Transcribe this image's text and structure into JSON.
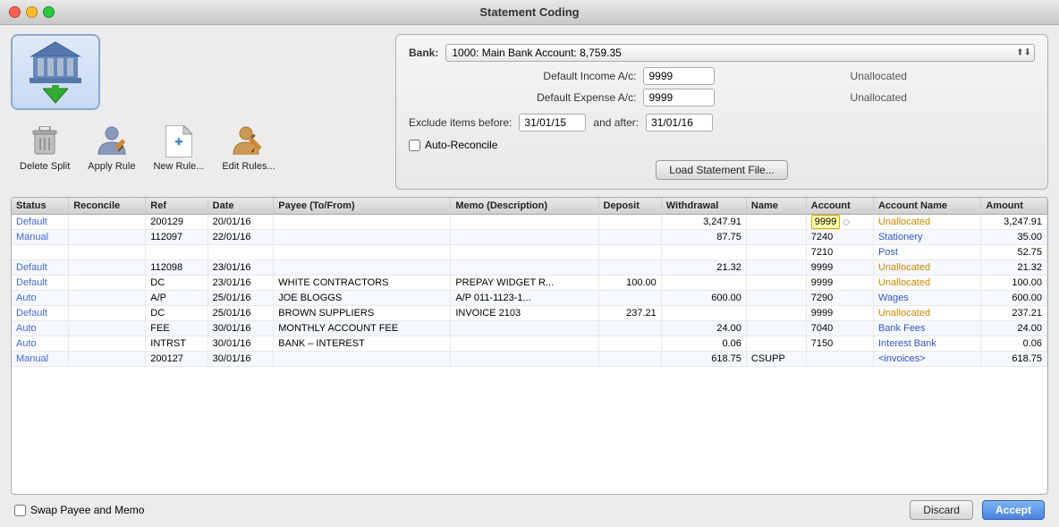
{
  "window": {
    "title": "Statement Coding"
  },
  "header": {
    "bank_label": "Bank:",
    "bank_value": "1000: Main Bank Account: 8,759.35",
    "default_income_label": "Default Income A/c:",
    "default_income_value": "9999",
    "default_income_note": "Unallocated",
    "default_expense_label": "Default Expense A/c:",
    "default_expense_value": "9999",
    "default_expense_note": "Unallocated",
    "exclude_before_label": "Exclude items before:",
    "exclude_before_value": "31/01/15",
    "and_after_label": "and after:",
    "exclude_after_value": "31/01/16",
    "auto_reconcile_label": "Auto-Reconcile",
    "load_btn": "Load Statement File..."
  },
  "toolbar": {
    "delete_split_label": "Delete Split",
    "apply_rule_label": "Apply Rule",
    "new_rule_label": "New Rule...",
    "edit_rules_label": "Edit Rules..."
  },
  "table": {
    "columns": [
      "Status",
      "Reconcile",
      "Ref",
      "Date",
      "Payee (To/From)",
      "Memo (Description)",
      "Deposit",
      "Withdrawal",
      "Name",
      "Account",
      "Account Name",
      "Amount"
    ],
    "rows": [
      {
        "status": "Default",
        "reconcile": "",
        "ref": "200129",
        "date": "20/01/16",
        "payee": "",
        "memo": "",
        "deposit": "",
        "withdrawal": "3,247.91",
        "name": "",
        "account": "9999",
        "account_arrow": "◇",
        "account_name": "Unallocated",
        "amount": "3,247.91",
        "status_class": "status-default",
        "acct_highlight": true
      },
      {
        "status": "Manual",
        "reconcile": "",
        "ref": "112097",
        "date": "22/01/16",
        "payee": "",
        "memo": "",
        "deposit": "",
        "withdrawal": "87.75",
        "name": "",
        "account": "7240",
        "account_arrow": "",
        "account_name": "Stationery",
        "amount": "35.00",
        "status_class": "status-manual",
        "acct_highlight": false
      },
      {
        "status": "",
        "reconcile": "",
        "ref": "",
        "date": "",
        "payee": "",
        "memo": "",
        "deposit": "",
        "withdrawal": "",
        "name": "",
        "account": "7210",
        "account_arrow": "",
        "account_name": "Post",
        "amount": "52.75",
        "status_class": "",
        "acct_highlight": false
      },
      {
        "status": "Default",
        "reconcile": "",
        "ref": "112098",
        "date": "23/01/16",
        "payee": "",
        "memo": "",
        "deposit": "",
        "withdrawal": "21.32",
        "name": "",
        "account": "9999",
        "account_arrow": "",
        "account_name": "Unallocated",
        "amount": "21.32",
        "status_class": "status-default",
        "acct_highlight": false
      },
      {
        "status": "Default",
        "reconcile": "",
        "ref": "DC",
        "date": "23/01/16",
        "payee": "WHITE CONTRACTORS",
        "memo": "PREPAY WIDGET R...",
        "deposit": "100.00",
        "withdrawal": "",
        "name": "",
        "account": "9999",
        "account_arrow": "",
        "account_name": "Unallocated",
        "amount": "100.00",
        "status_class": "status-default",
        "acct_highlight": false
      },
      {
        "status": "Auto",
        "reconcile": "",
        "ref": "A/P",
        "date": "25/01/16",
        "payee": "JOE BLOGGS",
        "memo": "A/P 011-1123-1...",
        "deposit": "",
        "withdrawal": "600.00",
        "name": "",
        "account": "7290",
        "account_arrow": "",
        "account_name": "Wages",
        "amount": "600.00",
        "status_class": "status-auto",
        "acct_highlight": false
      },
      {
        "status": "Default",
        "reconcile": "",
        "ref": "DC",
        "date": "25/01/16",
        "payee": "BROWN SUPPLIERS",
        "memo": "INVOICE 2103",
        "deposit": "237.21",
        "withdrawal": "",
        "name": "",
        "account": "9999",
        "account_arrow": "",
        "account_name": "Unallocated",
        "amount": "237.21",
        "status_class": "status-default",
        "acct_highlight": false
      },
      {
        "status": "Auto",
        "reconcile": "",
        "ref": "FEE",
        "date": "30/01/16",
        "payee": "MONTHLY ACCOUNT FEE",
        "memo": "",
        "deposit": "",
        "withdrawal": "24.00",
        "name": "",
        "account": "7040",
        "account_arrow": "",
        "account_name": "Bank Fees",
        "amount": "24.00",
        "status_class": "status-auto",
        "acct_highlight": false
      },
      {
        "status": "Auto",
        "reconcile": "",
        "ref": "INTRST",
        "date": "30/01/16",
        "payee": "BANK – INTEREST",
        "memo": "",
        "deposit": "",
        "withdrawal": "0.06",
        "name": "",
        "account": "7150",
        "account_arrow": "",
        "account_name": "Interest Bank",
        "amount": "0.06",
        "status_class": "status-auto",
        "acct_highlight": false
      },
      {
        "status": "Manual",
        "reconcile": "",
        "ref": "200127",
        "date": "30/01/16",
        "payee": "",
        "memo": "",
        "deposit": "",
        "withdrawal": "618.75",
        "name": "CSUPP",
        "account": "",
        "account_arrow": "",
        "account_name": "<invoices>",
        "amount": "618.75",
        "status_class": "status-manual",
        "acct_highlight": false
      }
    ]
  },
  "bottom": {
    "swap_label": "Swap Payee and Memo",
    "discard_btn": "Discard",
    "accept_btn": "Accept"
  }
}
